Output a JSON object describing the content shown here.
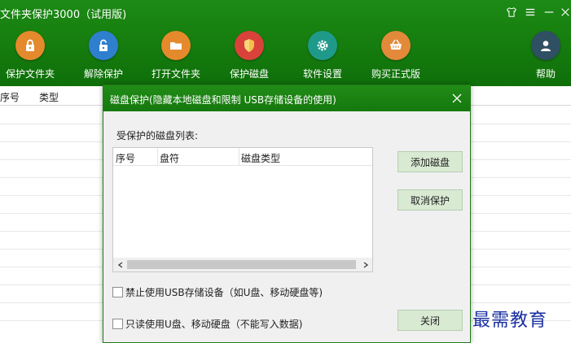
{
  "app": {
    "title": "文件夹保护3000（试用版)"
  },
  "toolbar": {
    "items": [
      {
        "label": "保护文件夹",
        "icon": "lock-icon",
        "color": "#e58a2c"
      },
      {
        "label": "解除保护",
        "icon": "unlock-icon",
        "color": "#2f7fcf"
      },
      {
        "label": "打开文件夹",
        "icon": "folder-icon",
        "color": "#e58a2c"
      },
      {
        "label": "保护磁盘",
        "icon": "shield-icon",
        "color": "#d8423a"
      },
      {
        "label": "软件设置",
        "icon": "gear-icon",
        "color": "#1f9a8a"
      },
      {
        "label": "购买正式版",
        "icon": "basket-icon",
        "color": "#e28a3a"
      },
      {
        "label": "帮助",
        "icon": "user-icon",
        "color": "#2f4f63"
      }
    ]
  },
  "main_table": {
    "columns": [
      "序号",
      "类型"
    ]
  },
  "dialog": {
    "title": "磁盘保护(隐藏本地磁盘和限制 USB存储设备的使用)",
    "list_label": "受保护的磁盘列表:",
    "list_columns": [
      "序号",
      "盘符",
      "磁盘类型"
    ],
    "buttons": {
      "add": "添加磁盘",
      "cancel_protect": "取消保护",
      "close": "关闭"
    },
    "checkboxes": [
      {
        "label": "禁止使用USB存储设备（如U盘、移动硬盘等)",
        "checked": false
      },
      {
        "label": "只读使用U盘、移动硬盘（不能写入数据)",
        "checked": false
      }
    ]
  },
  "watermark": "最需教育",
  "colors": {
    "header_green": "#17800f",
    "button_green": "#d9ead3",
    "watermark_blue": "#1a2fa0"
  }
}
